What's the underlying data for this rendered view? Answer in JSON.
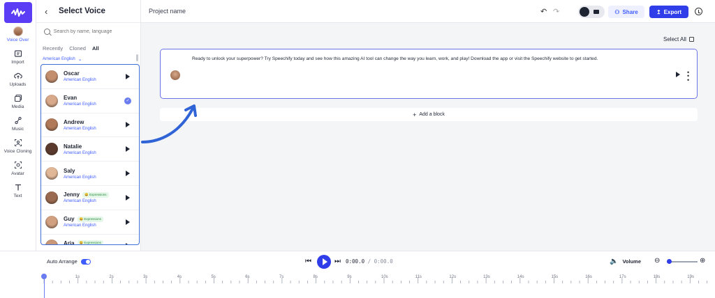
{
  "rail": {
    "items": [
      {
        "label": "Voice Over",
        "icon": "avatar-icon",
        "active": true
      },
      {
        "label": "Import",
        "icon": "import-icon"
      },
      {
        "label": "Uploads",
        "icon": "upload-cloud-icon"
      },
      {
        "label": "Media",
        "icon": "media-icon"
      },
      {
        "label": "Music",
        "icon": "music-icon"
      },
      {
        "label": "Voice Cloning",
        "icon": "voice-cloning-icon"
      },
      {
        "label": "Avatar",
        "icon": "avatar-frame-icon"
      },
      {
        "label": "Text",
        "icon": "text-icon"
      }
    ]
  },
  "panel": {
    "title": "Select Voice",
    "search_placeholder": "Search by name, language",
    "tabs": [
      "Recently",
      "Cloned",
      "All"
    ],
    "active_tab": "All",
    "language_filter": "American English",
    "voices": [
      {
        "name": "Oscar",
        "lang": "American English",
        "badge": "",
        "selected": false,
        "skin": "#c28e6e"
      },
      {
        "name": "Evan",
        "lang": "American English",
        "badge": "",
        "selected": true,
        "skin": "#d8a98a"
      },
      {
        "name": "Andrew",
        "lang": "American English",
        "badge": "",
        "selected": false,
        "skin": "#b07a5a"
      },
      {
        "name": "Natalie",
        "lang": "American English",
        "badge": "",
        "selected": false,
        "skin": "#5a3a2c"
      },
      {
        "name": "Saly",
        "lang": "American English",
        "badge": "",
        "selected": false,
        "skin": "#e0b898"
      },
      {
        "name": "Jenny",
        "lang": "American English",
        "badge": "😀 Expressions",
        "selected": false,
        "skin": "#9a6a50"
      },
      {
        "name": "Guy",
        "lang": "American English",
        "badge": "😀 Expressions",
        "selected": false,
        "skin": "#d0a080"
      },
      {
        "name": "Aria",
        "lang": "American English",
        "badge": "😀 Expressions",
        "selected": false,
        "skin": "#c89878"
      }
    ]
  },
  "topbar": {
    "project_name": "Project name",
    "share_label": "Share",
    "export_label": "Export"
  },
  "editor": {
    "select_all_label": "Select All",
    "block_text": "Ready to unlock your superpower? Try Speechify today and see how this amazing AI tool can change the way you learn, work, and play! Download the app or visit the Speechify website to get started.",
    "add_block_label": "Add a block"
  },
  "transport": {
    "auto_arrange_label": "Auto Arrange",
    "current_time": "0:00.0",
    "separator": "/",
    "total_time": "0:00.0",
    "volume_label": "Volume"
  },
  "timeline": {
    "ticks": [
      "1s",
      "2s",
      "3s",
      "4s",
      "5s",
      "6s",
      "7s",
      "8s",
      "9s",
      "10s",
      "11s",
      "12s",
      "13s",
      "14s",
      "15s",
      "16s",
      "17s",
      "18s",
      "19s"
    ]
  },
  "colors": {
    "accent": "#3e5cff",
    "brand": "#5b3df5",
    "export": "#2f3ee8"
  }
}
